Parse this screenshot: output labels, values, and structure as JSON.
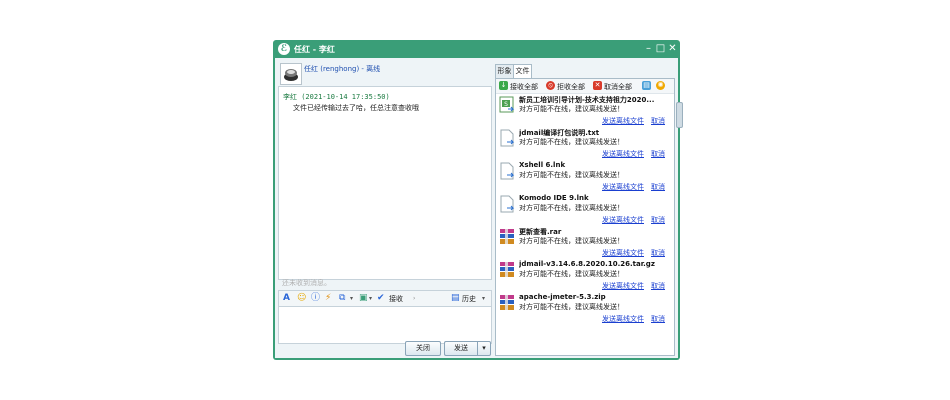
{
  "window": {
    "title": "任红 - 李红",
    "min": "–",
    "max": "□",
    "close": "✕"
  },
  "contact": {
    "name": "任红 (renghong) - 离线"
  },
  "history": {
    "header": "李红 (2021-10-14 17:35:50)",
    "body": "文件已经传输过去了哈，任总注意查收哦",
    "hint": "还未收到消息。"
  },
  "toolbar": {
    "shake_label": "接收",
    "history_label": "历史"
  },
  "buttons": {
    "close": "关闭",
    "send": "发送",
    "send_arrow": "▾"
  },
  "tabs": [
    "形象",
    "文件"
  ],
  "file_toolbar": {
    "accept_all": "接收全部",
    "reject_all": "拒收全部",
    "cancel_all": "取消全部"
  },
  "files": [
    {
      "name": "新员工培训引导计划-技术支持祖力2020...",
      "status": "对方可能不在线，建议离线发送！",
      "icon": "document-icon"
    },
    {
      "name": "jdmail编译打包说明.txt",
      "status": "对方可能不在线，建议离线发送！",
      "icon": "file-icon"
    },
    {
      "name": "Xshell 6.lnk",
      "status": "对方可能不在线，建议离线发送！",
      "icon": "file-icon"
    },
    {
      "name": "Komodo IDE 9.lnk",
      "status": "对方可能不在线，建议离线发送！",
      "icon": "file-icon"
    },
    {
      "name": "更新查看.rar",
      "status": "对方可能不在线，建议离线发送！",
      "icon": "archive-icon"
    },
    {
      "name": "jdmail-v3.14.6.8.2020.10.26.tar.gz",
      "status": "对方可能不在线，建议离线发送！",
      "icon": "archive-icon"
    },
    {
      "name": "apache-jmeter-5.3.zip",
      "status": "对方可能不在线，建议离线发送！",
      "icon": "archive-icon"
    }
  ],
  "file_links": {
    "offline": "发送离线文件",
    "cancel": "取消"
  },
  "colors": {
    "titlebar": "#3a9e78",
    "link": "#1a3fd0"
  }
}
